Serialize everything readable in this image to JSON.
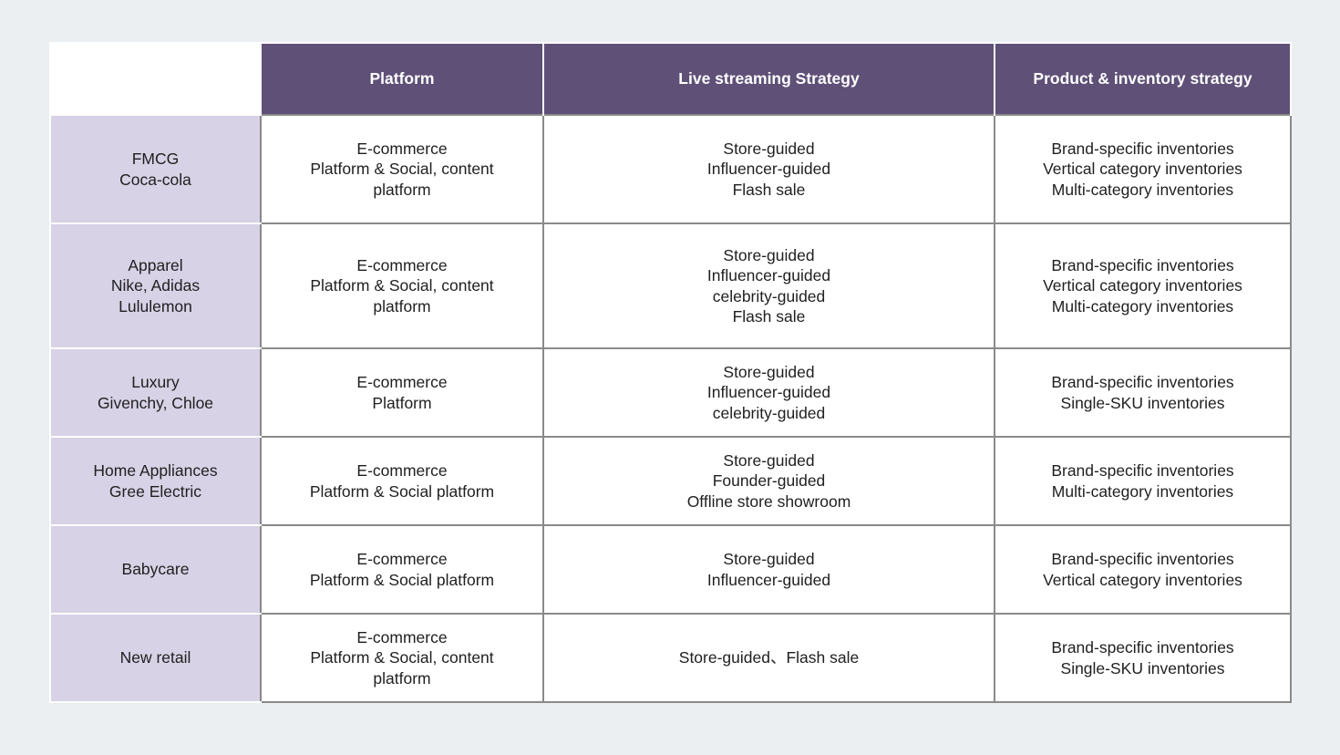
{
  "table": {
    "headers": [
      "",
      "Platform",
      "Live streaming Strategy",
      "Product & inventory strategy"
    ],
    "rows": [
      {
        "category": [
          "FMCG",
          "Coca-cola"
        ],
        "platform": [
          "E-commerce",
          "Platform & Social, content",
          "platform"
        ],
        "live": [
          "Store-guided",
          "Influencer-guided",
          "Flash sale"
        ],
        "inventory": [
          "Brand-specific inventories",
          "Vertical category inventories",
          "Multi-category inventories"
        ]
      },
      {
        "category": [
          "Apparel",
          "Nike, Adidas",
          "Lululemon"
        ],
        "platform": [
          "E-commerce",
          "Platform & Social, content",
          "platform"
        ],
        "live": [
          "Store-guided",
          "Influencer-guided",
          "celebrity-guided",
          "Flash sale"
        ],
        "inventory": [
          "Brand-specific inventories",
          "Vertical category inventories",
          "Multi-category inventories"
        ]
      },
      {
        "category": [
          "Luxury",
          "Givenchy, Chloe"
        ],
        "platform": [
          "E-commerce",
          "Platform"
        ],
        "live": [
          "Store-guided",
          "Influencer-guided",
          "celebrity-guided"
        ],
        "inventory": [
          "Brand-specific inventories",
          "Single-SKU inventories"
        ]
      },
      {
        "category": [
          "Home Appliances",
          "Gree Electric"
        ],
        "platform": [
          "E-commerce",
          "Platform & Social platform"
        ],
        "live": [
          "Store-guided",
          "Founder-guided",
          "Offline store showroom"
        ],
        "inventory": [
          "Brand-specific inventories",
          "Multi-category inventories"
        ]
      },
      {
        "category": [
          "Babycare"
        ],
        "platform": [
          "E-commerce",
          "Platform & Social platform"
        ],
        "live": [
          "Store-guided",
          "Influencer-guided"
        ],
        "inventory": [
          "Brand-specific inventories",
          "Vertical category inventories"
        ]
      },
      {
        "category": [
          "New retail"
        ],
        "platform": [
          "E-commerce",
          "Platform & Social, content",
          "platform"
        ],
        "live": [
          "Store-guided、Flash sale"
        ],
        "inventory": [
          "Brand-specific inventories",
          "Single-SKU inventories"
        ]
      }
    ]
  },
  "colors": {
    "header_bg": "#5f5077",
    "rowhead_bg": "#d7d2e6",
    "page_bg": "#ebeff2"
  }
}
